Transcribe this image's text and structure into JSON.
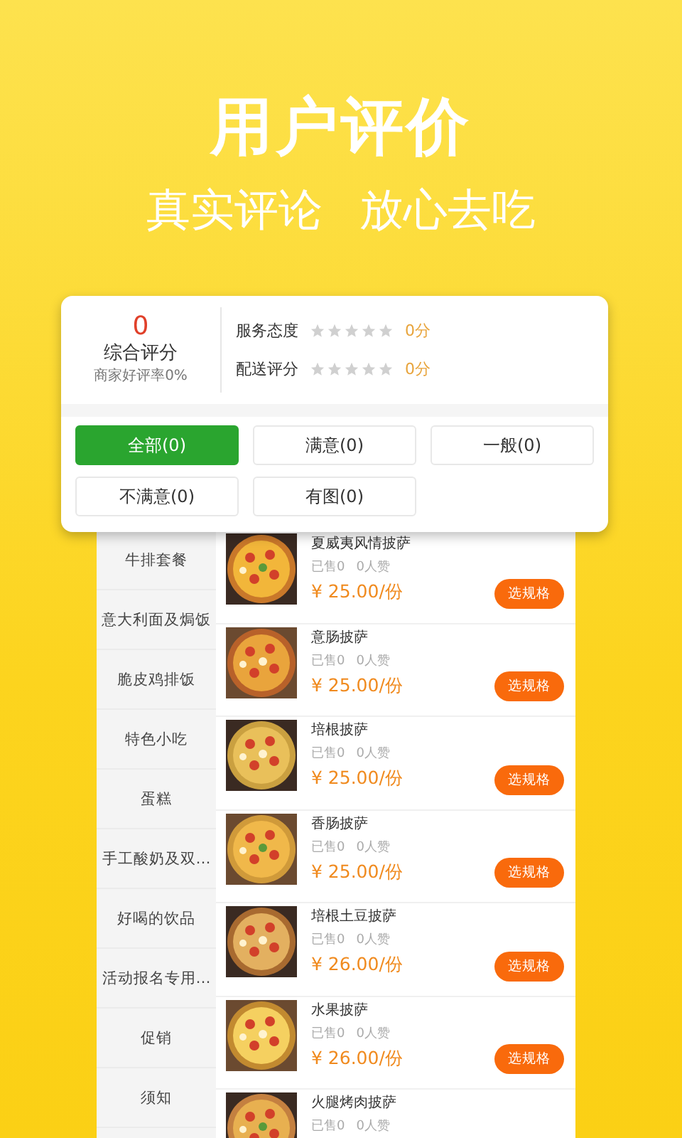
{
  "headline": "用户评价",
  "taglines": [
    "真实评论",
    "放心去吃"
  ],
  "rating": {
    "score": "0",
    "label": "综合评分",
    "rate": "商家好评率0%",
    "aspects": [
      {
        "name": "服务态度",
        "stars": 0,
        "score": "0分"
      },
      {
        "name": "配送评分",
        "stars": 0,
        "score": "0分"
      }
    ]
  },
  "filters": [
    {
      "label": "全部(0)",
      "selected": true
    },
    {
      "label": "满意(0)",
      "selected": false
    },
    {
      "label": "一般(0)",
      "selected": false
    },
    {
      "label": "不满意(0)",
      "selected": false
    },
    {
      "label": "有图(0)",
      "selected": false
    }
  ],
  "categories": [
    "牛排套餐",
    "意大利面及焗饭",
    "脆皮鸡排饭",
    "特色小吃",
    "蛋糕",
    "手工酸奶及双…",
    "好喝的饮品",
    "活动报名专用…",
    "促销",
    "须知"
  ],
  "products": [
    {
      "name": "夏威夷风情披萨",
      "sold": "已售0",
      "likes": "0人赞",
      "price": "¥ 25.00/份",
      "button": "选规格"
    },
    {
      "name": "意肠披萨",
      "sold": "已售0",
      "likes": "0人赞",
      "price": "¥ 25.00/份",
      "button": "选规格"
    },
    {
      "name": "培根披萨",
      "sold": "已售0",
      "likes": "0人赞",
      "price": "¥ 25.00/份",
      "button": "选规格"
    },
    {
      "name": "香肠披萨",
      "sold": "已售0",
      "likes": "0人赞",
      "price": "¥ 25.00/份",
      "button": "选规格"
    },
    {
      "name": "培根土豆披萨",
      "sold": "已售0",
      "likes": "0人赞",
      "price": "¥ 26.00/份",
      "button": "选规格"
    },
    {
      "name": "水果披萨",
      "sold": "已售0",
      "likes": "0人赞",
      "price": "¥ 26.00/份",
      "button": "选规格"
    },
    {
      "name": "火腿烤肉披萨",
      "sold": "已售0",
      "likes": "0人赞"
    }
  ]
}
